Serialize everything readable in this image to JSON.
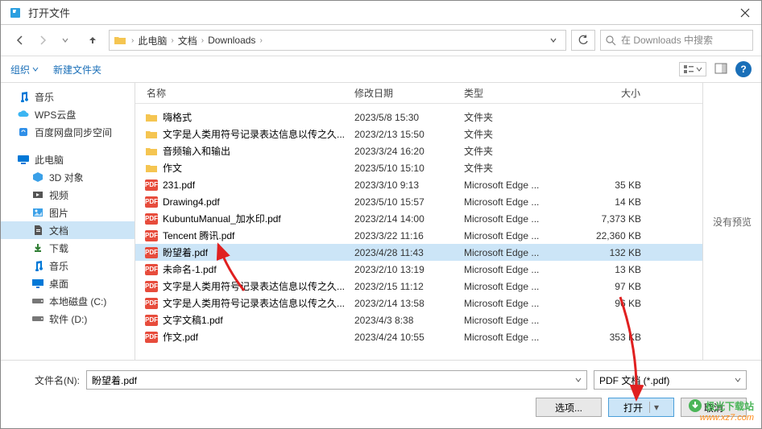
{
  "window": {
    "title": "打开文件"
  },
  "nav": {
    "breadcrumb": [
      "此电脑",
      "文档",
      "Downloads"
    ],
    "refresh_label": "刷新",
    "search_placeholder": "在 Downloads 中搜索"
  },
  "toolbar": {
    "organize": "组织",
    "new_folder": "新建文件夹",
    "help": "?"
  },
  "sidebar": {
    "items": [
      {
        "label": "音乐",
        "icon": "music",
        "color": "#0078d7"
      },
      {
        "label": "WPS云盘",
        "icon": "cloud",
        "color": "#3cb5f2"
      },
      {
        "label": "百度网盘同步空间",
        "icon": "sync",
        "color": "#2f8fe8",
        "truncated": true
      }
    ],
    "thispc": {
      "label": "此电脑",
      "icon": "pc",
      "color": "#0078d7"
    },
    "subitems": [
      {
        "label": "3D 对象",
        "icon": "3d",
        "color": "#3aa0e8"
      },
      {
        "label": "视频",
        "icon": "video",
        "color": "#555"
      },
      {
        "label": "图片",
        "icon": "image",
        "color": "#3aa0e8"
      },
      {
        "label": "文档",
        "icon": "doc",
        "color": "#555",
        "selected": true
      },
      {
        "label": "下载",
        "icon": "download",
        "color": "#2e7d32"
      },
      {
        "label": "音乐",
        "icon": "music",
        "color": "#0078d7"
      },
      {
        "label": "桌面",
        "icon": "desktop",
        "color": "#0078d7"
      },
      {
        "label": "本地磁盘 (C:)",
        "icon": "drive",
        "color": "#777"
      },
      {
        "label": "软件 (D:)",
        "icon": "drive",
        "color": "#777"
      }
    ]
  },
  "filelist": {
    "headers": {
      "name": "名称",
      "date": "修改日期",
      "type": "类型",
      "size": "大小"
    },
    "rows": [
      {
        "name": "嗨格式",
        "date": "2023/5/8 15:30",
        "type": "文件夹",
        "size": "",
        "kind": "folder"
      },
      {
        "name": "文字是人类用符号记录表达信息以传之久...",
        "date": "2023/2/13 15:50",
        "type": "文件夹",
        "size": "",
        "kind": "folder"
      },
      {
        "name": "音频输入和输出",
        "date": "2023/3/24 16:20",
        "type": "文件夹",
        "size": "",
        "kind": "folder"
      },
      {
        "name": "作文",
        "date": "2023/5/10 15:10",
        "type": "文件夹",
        "size": "",
        "kind": "folder"
      },
      {
        "name": "231.pdf",
        "date": "2023/3/10 9:13",
        "type": "Microsoft Edge ...",
        "size": "35 KB",
        "kind": "pdf"
      },
      {
        "name": "Drawing4.pdf",
        "date": "2023/5/10 15:57",
        "type": "Microsoft Edge ...",
        "size": "14 KB",
        "kind": "pdf"
      },
      {
        "name": "KubuntuManual_加水印.pdf",
        "date": "2023/2/14 14:00",
        "type": "Microsoft Edge ...",
        "size": "7,373 KB",
        "kind": "pdf"
      },
      {
        "name": "Tencent 腾讯.pdf",
        "date": "2023/3/22 11:16",
        "type": "Microsoft Edge ...",
        "size": "22,360 KB",
        "kind": "pdf"
      },
      {
        "name": "盼望着.pdf",
        "date": "2023/4/28 11:43",
        "type": "Microsoft Edge ...",
        "size": "132 KB",
        "kind": "pdf",
        "selected": true
      },
      {
        "name": "未命名-1.pdf",
        "date": "2023/2/10 13:19",
        "type": "Microsoft Edge ...",
        "size": "13 KB",
        "kind": "pdf"
      },
      {
        "name": "文字是人类用符号记录表达信息以传之久...",
        "date": "2023/2/15 11:12",
        "type": "Microsoft Edge ...",
        "size": "97 KB",
        "kind": "pdf"
      },
      {
        "name": "文字是人类用符号记录表达信息以传之久...",
        "date": "2023/2/14 13:58",
        "type": "Microsoft Edge ...",
        "size": "96 KB",
        "kind": "pdf"
      },
      {
        "name": "文字文稿1.pdf",
        "date": "2023/4/3 8:38",
        "type": "Microsoft Edge ...",
        "size": "",
        "kind": "pdf"
      },
      {
        "name": "作文.pdf",
        "date": "2023/4/24 10:55",
        "type": "Microsoft Edge ...",
        "size": "353 KB",
        "kind": "pdf"
      }
    ]
  },
  "preview": {
    "text": "没有预览"
  },
  "footer": {
    "filename_label": "文件名(N):",
    "filename_value": "盼望着.pdf",
    "filter_label": "PDF 文档 (*.pdf)",
    "options_btn": "选项...",
    "open_btn": "打开",
    "cancel_btn": "取消"
  },
  "watermark": {
    "line1": "极光下载站",
    "line2": "www.xz7.com"
  }
}
